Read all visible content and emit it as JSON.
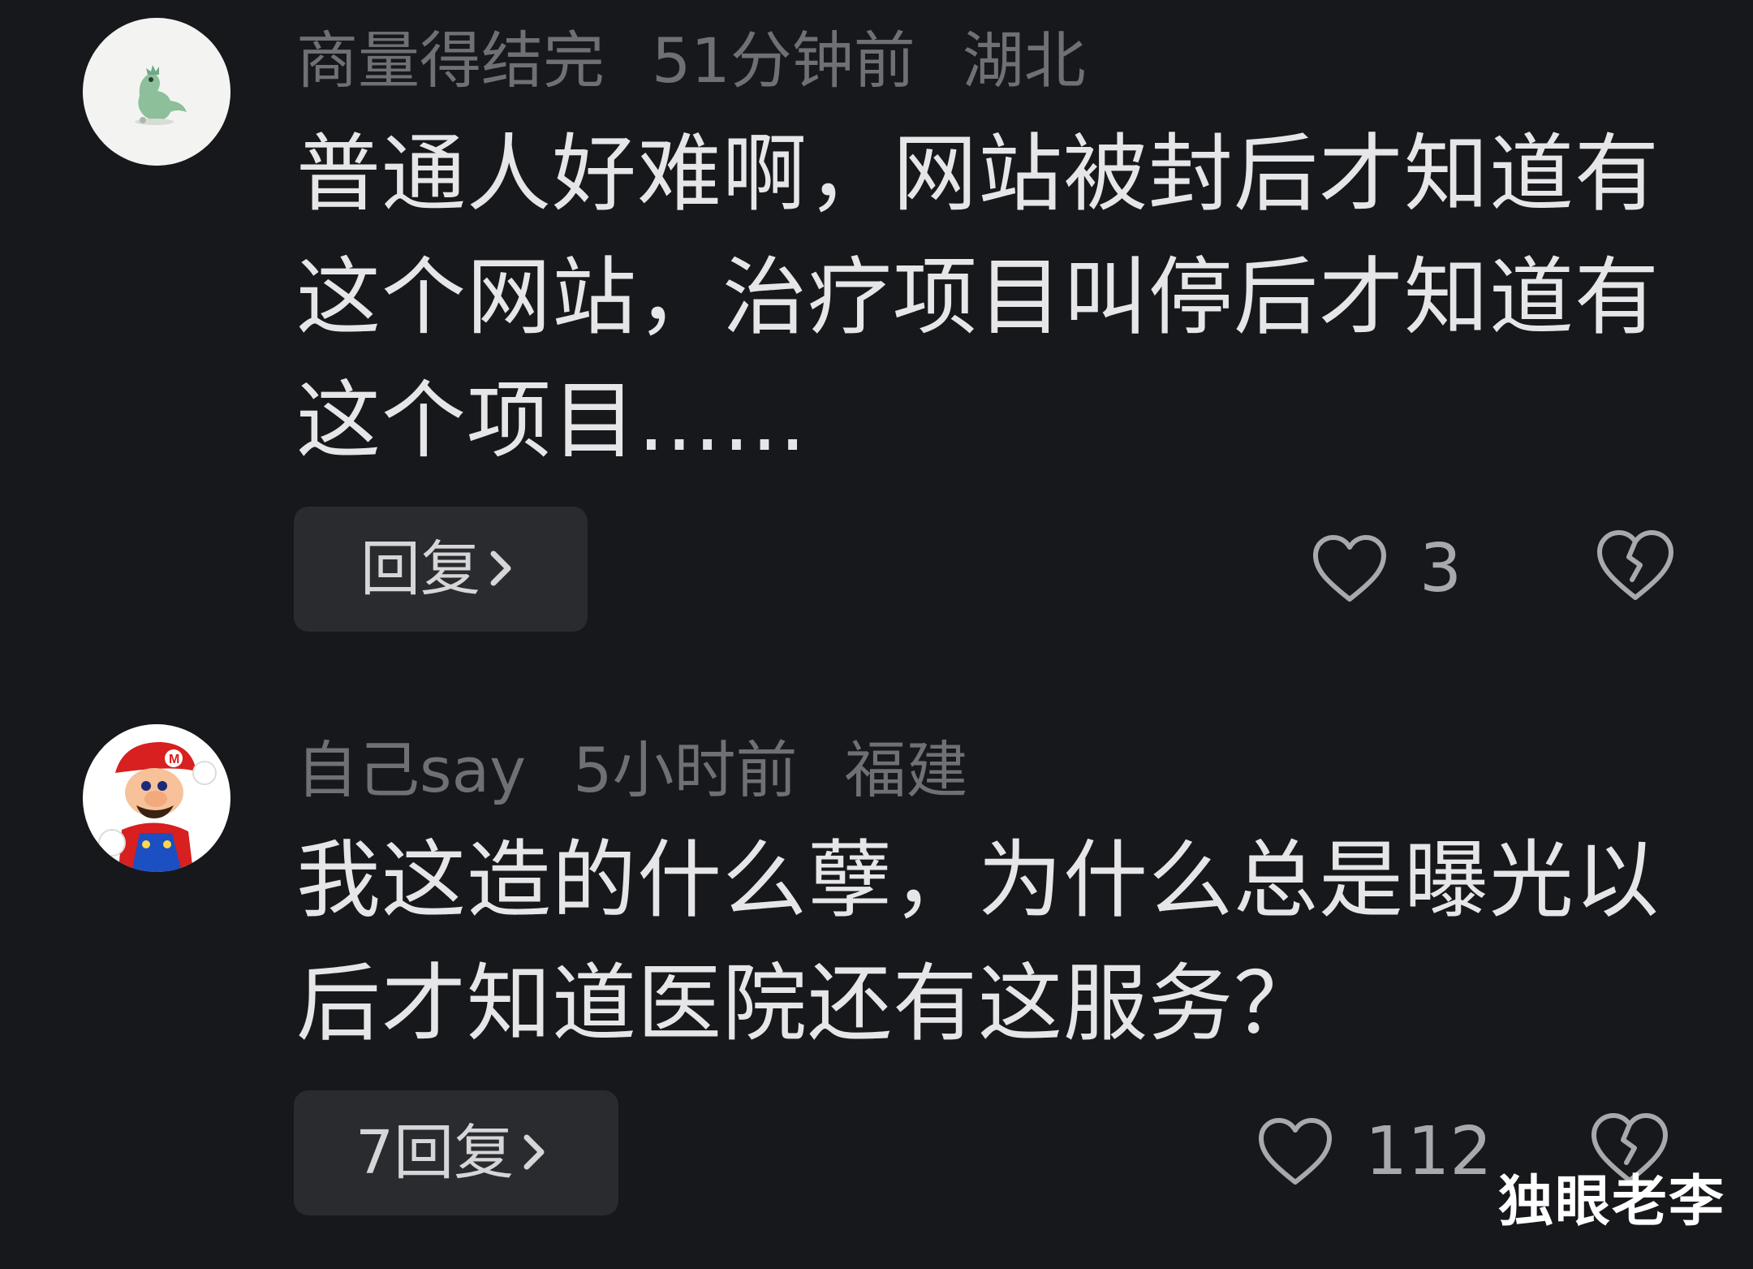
{
  "comments": [
    {
      "username": "商量得结完",
      "time": "51分钟前",
      "location": "湖北",
      "text": "普通人好难啊，网站被封后才知道有这个网站，治疗项目叫停后才知道有这个项目……",
      "reply_label": "回复",
      "like_count": "3",
      "avatar_icon": "dinosaur-avatar-icon"
    },
    {
      "username": "自己say",
      "time": "5小时前",
      "location": "福建",
      "text": "我这造的什么孽，为什么总是曝光以后才知道医院还有这服务？",
      "reply_label": "7回复",
      "like_count": "112",
      "avatar_icon": "mario-avatar-icon"
    }
  ],
  "watermark": "独眼老李",
  "colors": {
    "background": "#17181b",
    "meta_text": "#6f7075",
    "body_text": "#e6e6e8",
    "reply_button_bg": "#2a2b2f",
    "icon": "#a8a9ad"
  }
}
